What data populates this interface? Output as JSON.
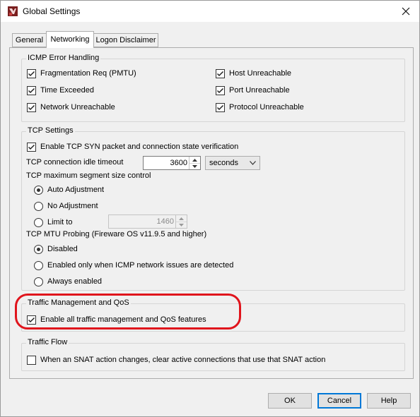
{
  "window": {
    "title": "Global Settings",
    "icon": "app-icon",
    "close_icon": "close-icon"
  },
  "tabs": [
    {
      "label": "General",
      "active": false
    },
    {
      "label": "Networking",
      "active": true
    },
    {
      "label": "Logon Disclaimer",
      "active": false
    }
  ],
  "icmp": {
    "legend": "ICMP Error Handling",
    "items": [
      {
        "label": "Fragmentation Req (PMTU)",
        "checked": true
      },
      {
        "label": "Time Exceeded",
        "checked": true
      },
      {
        "label": "Network Unreachable",
        "checked": true
      },
      {
        "label": "Host Unreachable",
        "checked": true
      },
      {
        "label": "Port Unreachable",
        "checked": true
      },
      {
        "label": "Protocol Unreachable",
        "checked": true
      }
    ]
  },
  "tcp": {
    "legend": "TCP Settings",
    "syn_label": "Enable TCP SYN packet and connection state verification",
    "syn_checked": true,
    "idle_label": "TCP connection idle timeout",
    "idle_value": "3600",
    "idle_unit": "seconds",
    "mss_label": "TCP maximum segment size control",
    "mss_options": [
      "Auto Adjustment",
      "No Adjustment",
      "Limit to"
    ],
    "mss_selected": "Auto Adjustment",
    "limit_value": "1460",
    "mtu_label": "TCP MTU Probing (Fireware OS v11.9.5 and higher)",
    "mtu_options": [
      "Disabled",
      "Enabled only when ICMP network issues are detected",
      "Always enabled"
    ],
    "mtu_selected": "Disabled"
  },
  "qos": {
    "legend": "Traffic Management and QoS",
    "label": "Enable all traffic management and QoS features",
    "checked": true
  },
  "flow": {
    "legend": "Traffic Flow",
    "label": "When an SNAT action changes, clear active connections that use that SNAT action",
    "checked": false
  },
  "buttons": {
    "ok": "OK",
    "cancel": "Cancel",
    "help": "Help"
  },
  "colors": {
    "highlight": "#e0141c",
    "default_button_border": "#0078d7"
  }
}
